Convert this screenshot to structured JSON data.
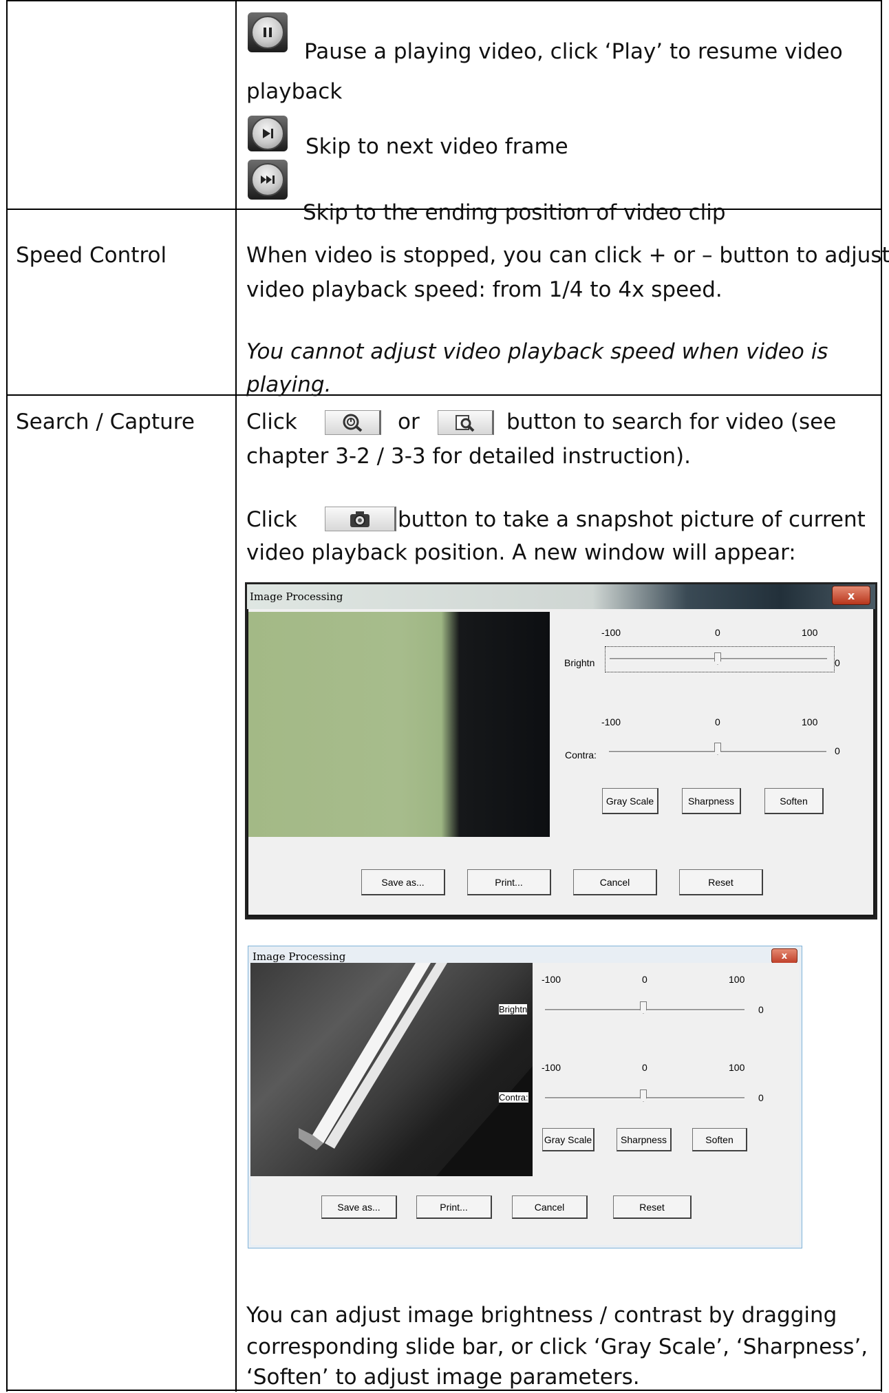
{
  "rows": [
    {
      "items": [
        {
          "icon": "pause-icon",
          "text_line1": "Pause a playing video, click ‘Play’ to resume video",
          "text_line2": "playback"
        },
        {
          "icon": "next-frame-icon",
          "text": "Skip to next video frame"
        },
        {
          "icon": "skip-to-end-icon",
          "text": "Skip to the ending position of video clip"
        }
      ]
    },
    {
      "label": "Speed Control",
      "line1": "When video is stopped, you can click + or – button to adjust",
      "line2": "video playback speed: from 1/4 to 4x speed.",
      "italic_line1": "You cannot adjust video playback speed when video is",
      "italic_line2": "playing."
    },
    {
      "label": "Search / Capture",
      "search": {
        "click": "Click",
        "or": "or",
        "rest": "button to search for video (see",
        "line2": "chapter 3-2 / 3-3 for detailed instruction).",
        "icon1": "clock-search-icon",
        "icon2": "magnifier-search-icon"
      },
      "capture": {
        "click": "Click",
        "rest": "button to take a snapshot picture of current",
        "line2": "video playback position. A new window will appear:",
        "icon": "camera-icon"
      },
      "footer_line1": "You can adjust image brightness / contrast by dragging",
      "footer_line2": "corresponding slide bar, or click ‘Gray Scale’, ‘Sharpness’,",
      "footer_line3": "‘Soften’ to adjust image parameters."
    }
  ],
  "dialogs": [
    {
      "title": "Image Processing",
      "close": "x",
      "brightness": {
        "min": "-100",
        "mid": "0",
        "max": "100",
        "label": "Brightn",
        "value": "0",
        "level": 0
      },
      "contrast": {
        "min": "-100",
        "mid": "0",
        "max": "100",
        "label": "Contra:",
        "value": "0",
        "level": 0
      },
      "gray_scale": "Gray Scale",
      "sharpness": "Sharpness",
      "soften": "Soften",
      "save_as": "Save as...",
      "print": "Print...",
      "cancel": "Cancel",
      "reset": "Reset"
    },
    {
      "title": "Image Processing",
      "close": "x",
      "brightness": {
        "min": "-100",
        "mid": "0",
        "max": "100",
        "label": "Brightn",
        "value": "0",
        "level": 0
      },
      "contrast": {
        "min": "-100",
        "mid": "0",
        "max": "100",
        "label": "Contra:",
        "value": "0",
        "level": 0
      },
      "gray_scale": "Gray Scale",
      "sharpness": "Sharpness",
      "soften": "Soften",
      "save_as": "Save as...",
      "print": "Print...",
      "cancel": "Cancel",
      "reset": "Reset"
    }
  ]
}
